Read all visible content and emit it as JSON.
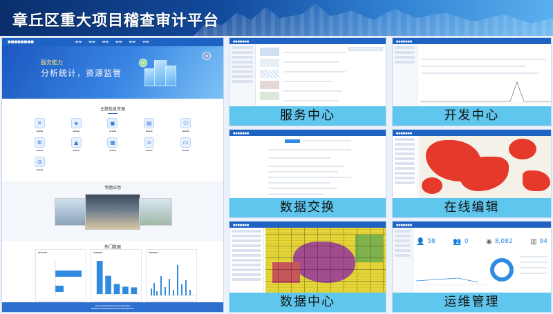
{
  "header": {
    "title": "章丘区重大项目稽查审计平台"
  },
  "portal": {
    "hero_line1": "服务能力",
    "hero_line2": "分析统计，资源监管",
    "section_resources": "主题信息资源",
    "section_special": "专题应用",
    "section_hot": "热门数据"
  },
  "panels": [
    {
      "caption": "服务中心"
    },
    {
      "caption": "开发中心"
    },
    {
      "caption": "数据交换"
    },
    {
      "caption": "在线编辑"
    },
    {
      "caption": "数据中心"
    },
    {
      "caption": "运维管理"
    }
  ],
  "ops": {
    "stat1": "58",
    "stat2": "0",
    "stat3": "8,082",
    "stat4": "94"
  },
  "colors": {
    "banner_dark": "#0b2f6d",
    "nav_blue": "#1e63c4",
    "caption_bg": "#5fc6ee",
    "map_red": "#e5392b",
    "map_yellow": "#e4d63a",
    "map_purple": "#a14c8c"
  },
  "chart_data": {
    "type": "bar",
    "categories": [
      "",
      "",
      "",
      "",
      ""
    ],
    "values": [
      100,
      55,
      30,
      22,
      20
    ],
    "title": "",
    "xlabel": "",
    "ylabel": ""
  }
}
